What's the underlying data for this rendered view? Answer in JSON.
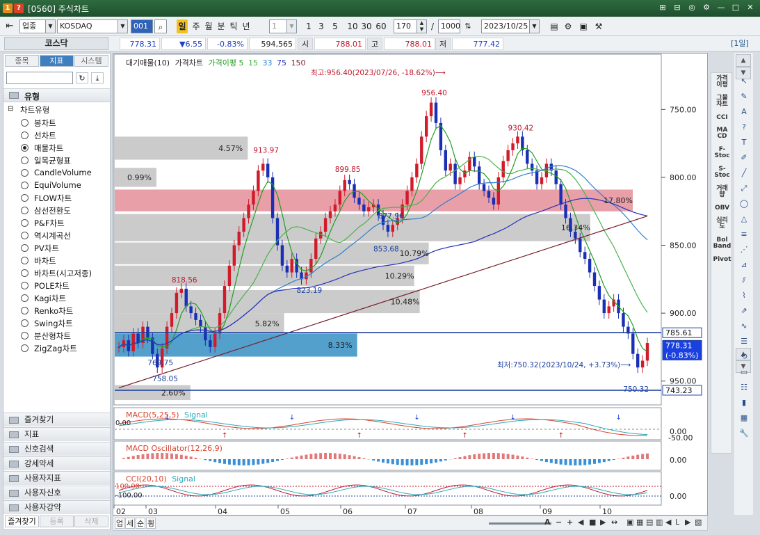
{
  "window": {
    "badge1": "1",
    "badge2": "?",
    "title": "[0560] 주식차트",
    "controls": [
      "⊞",
      "⊟",
      "◎",
      "⚙",
      "—",
      "□",
      "✕"
    ]
  },
  "toolbar": {
    "market": "업종",
    "index_name": "KOSDAQ",
    "code": "001",
    "period_active": "일",
    "periods": [
      "주",
      "월",
      "분",
      "틱",
      "년"
    ],
    "interval": "1",
    "quick_counts": [
      "1",
      "3",
      "5",
      "10",
      "30",
      "60"
    ],
    "display_count": "170",
    "separator": "/",
    "total_count": "1000",
    "date": "2023/10/25"
  },
  "quote": {
    "name": "코스닥",
    "price": "778.31",
    "change": "▼6.55",
    "change_pct": "-0.83%",
    "volume": "594,565",
    "open_label": "시",
    "open": "788.01",
    "high_label": "고",
    "high": "788.01",
    "low_label": "저",
    "low": "777.42",
    "period_tag": "[1일]"
  },
  "left_panel": {
    "tabs": [
      "종목",
      "지표",
      "시스템"
    ],
    "active_tab": "지표",
    "section": "유형",
    "tree_root": "차트유형",
    "chart_types": [
      "봉차트",
      "선차트",
      "매물차트",
      "일목균형표",
      "CandleVolume",
      "EquiVolume",
      "FLOW차트",
      "삼선전환도",
      "P&F차트",
      "역시계곡선",
      "PV차트",
      "바차트",
      "바차트(시고저종)",
      "POLE차트",
      "Kagi차트",
      "Renko차트",
      "Swing차트",
      "분산형차트",
      "ZigZag차트"
    ],
    "selected_type": "매물차트",
    "folders": [
      "즐겨찾기",
      "지표",
      "신호검색",
      "강세약세",
      "사용자지표",
      "사용자신호",
      "사용자강약"
    ],
    "bottom_tabs": [
      "즐겨찾기",
      "등록",
      "삭제"
    ]
  },
  "main_chart": {
    "legend": {
      "vol_profile": "대기매물(10)",
      "price": "가격차트",
      "ma_label": "가격이평",
      "ma_values": [
        "5",
        "15",
        "33",
        "75",
        "150"
      ],
      "ma_colors": [
        "#1f9f1f",
        "#49b24a",
        "#2e7fd0",
        "#2430b8",
        "#7a1f2b"
      ]
    },
    "high_annot": "최고:956.40(2023/07/26, -18.62%)⟶",
    "low_annot": "최저:750.32(2023/10/24, +3.73%)⟶",
    "price_labels_red": [
      "818.56",
      "913.97",
      "899.85",
      "956.40",
      "930.42"
    ],
    "price_labels_blue": [
      "769.75",
      "758.05",
      "823.19",
      "853.68",
      "877.96",
      "750.32"
    ],
    "profile_pcts": [
      "4.57%",
      "0.99%",
      "17.80%",
      "16.34%",
      "10.79%",
      "10.29%",
      "10.48%",
      "5.82%",
      "8.33%",
      "2.60%"
    ],
    "y_ticks": [
      "950.00",
      "900.00",
      "850.00",
      "800.00",
      "750.00"
    ],
    "current_line": "785.61",
    "current_price": "778.31",
    "current_pct": "(-0.83%)",
    "low_line": "743.23",
    "months": [
      "02",
      "03",
      "04",
      "05",
      "06",
      "07",
      "08",
      "09",
      "10"
    ]
  },
  "macd": {
    "title": "MACD(5,25,5)",
    "signal": "Signal",
    "tick_top": "0.00",
    "tick_mid": "0.00",
    "tick_bot": "-50.00"
  },
  "osc": {
    "title": "MACD Oscillator(12,26,9)",
    "tick": "0.00"
  },
  "cci": {
    "title": "CCI(20,10)",
    "signal": "Signal",
    "tick_top": "100.00",
    "tick_bot": "-100.00",
    "tick": "0.00"
  },
  "right_tools": [
    "가격\n이평",
    "그물\n차트",
    "CCI",
    "MA\nCD",
    "F-\nStoc",
    "S-\nStoc",
    "거래\n량",
    "OBV",
    "심리\n도",
    "Bol\nBand",
    "Pivot"
  ],
  "bottom_buttons": [
    "업",
    "세",
    "순",
    "휭"
  ],
  "chart_data": {
    "type": "candlestick",
    "title": "",
    "x_labels": [
      "02",
      "03",
      "04",
      "05",
      "06",
      "07",
      "08",
      "09",
      "10"
    ],
    "ylim": [
      735,
      985
    ],
    "y_ticks": [
      750,
      800,
      850,
      900,
      950
    ],
    "series": [
      {
        "name": "가격이평 5",
        "color": "#1f9f1f"
      },
      {
        "name": "15",
        "color": "#49b24a"
      },
      {
        "name": "33",
        "color": "#2e7fd0"
      },
      {
        "name": "75",
        "color": "#2430b8"
      },
      {
        "name": "150",
        "color": "#7a1f2b"
      }
    ],
    "key_points": [
      {
        "label": "818.56",
        "value": 818.56
      },
      {
        "label": "769.75",
        "value": 769.75
      },
      {
        "label": "758.05",
        "value": 758.05
      },
      {
        "label": "913.97",
        "value": 913.97
      },
      {
        "label": "823.19",
        "value": 823.19
      },
      {
        "label": "899.85",
        "value": 899.85
      },
      {
        "label": "853.68",
        "value": 853.68
      },
      {
        "label": "956.40",
        "value": 956.4
      },
      {
        "label": "877.96",
        "value": 877.96
      },
      {
        "label": "930.42",
        "value": 930.42
      },
      {
        "label": "750.32",
        "value": 750.32
      }
    ],
    "volume_profile_pct": [
      2.6,
      8.33,
      5.82,
      10.48,
      10.29,
      10.79,
      16.34,
      17.8,
      0.99,
      4.57
    ],
    "horizontal_lines": [
      785.61,
      743.23
    ],
    "last": 778.31
  }
}
